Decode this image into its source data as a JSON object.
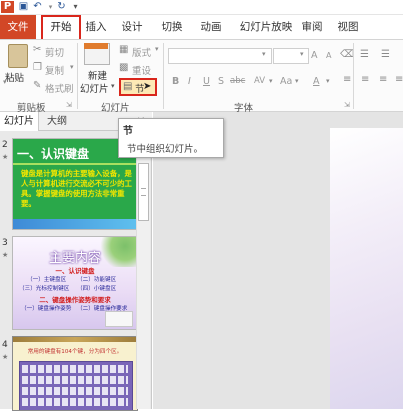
{
  "tabs": {
    "file": "文件",
    "home": "开始",
    "insert": "插入",
    "design": "设计",
    "transitions": "切换",
    "animations": "动画",
    "slideshow": "幻灯片放映",
    "review": "审阅",
    "view": "视图"
  },
  "clipboard": {
    "paste": "粘贴",
    "cut": "剪切",
    "copy": "复制",
    "format_painter": "格式刷",
    "group_label": "剪贴板"
  },
  "slides_group": {
    "new_slide_line1": "新建",
    "new_slide_line2": "幻灯片",
    "layout": "版式",
    "reset": "重设",
    "section": "节",
    "group_label": "幻灯片"
  },
  "font_group": {
    "group_label": "字体",
    "bold": "B",
    "italic": "I",
    "underline": "U",
    "strike": "S",
    "shadow": "abc",
    "spacing": "AV",
    "case": "Aa",
    "grow": "A",
    "shrink": "A"
  },
  "pane_tabs": {
    "slides": "幻灯片",
    "outline": "大纲"
  },
  "thumbnails": [
    {
      "number": "2",
      "title": "一、认识键盘",
      "body": "键盘是计算机的主要输入设备，是人与计算机进行交流必不可少的工具。掌握键盘的使用方法非常重要。"
    },
    {
      "number": "3",
      "title": "主要内容",
      "items": [
        "一、认识键盘",
        "（一）主键盘区",
        "（二）功能键区",
        "（三）光标控制键区",
        "（四）小键盘区",
        "二、键盘操作姿势和要求",
        "（一）键盘操作姿势",
        "（二）键盘操作要求"
      ]
    },
    {
      "number": "4",
      "caption": "常用的键盘有104个键，分为四个区。"
    }
  ],
  "tooltip": {
    "title": "节",
    "description": "节中组织幻灯片。"
  },
  "colors": {
    "file_tab": "#d24726",
    "highlight_border": "#d9261c",
    "thumb2_bg": "#2aa84a",
    "thumb2_title": "#ffffff",
    "thumb2_body": "#f2e600"
  }
}
